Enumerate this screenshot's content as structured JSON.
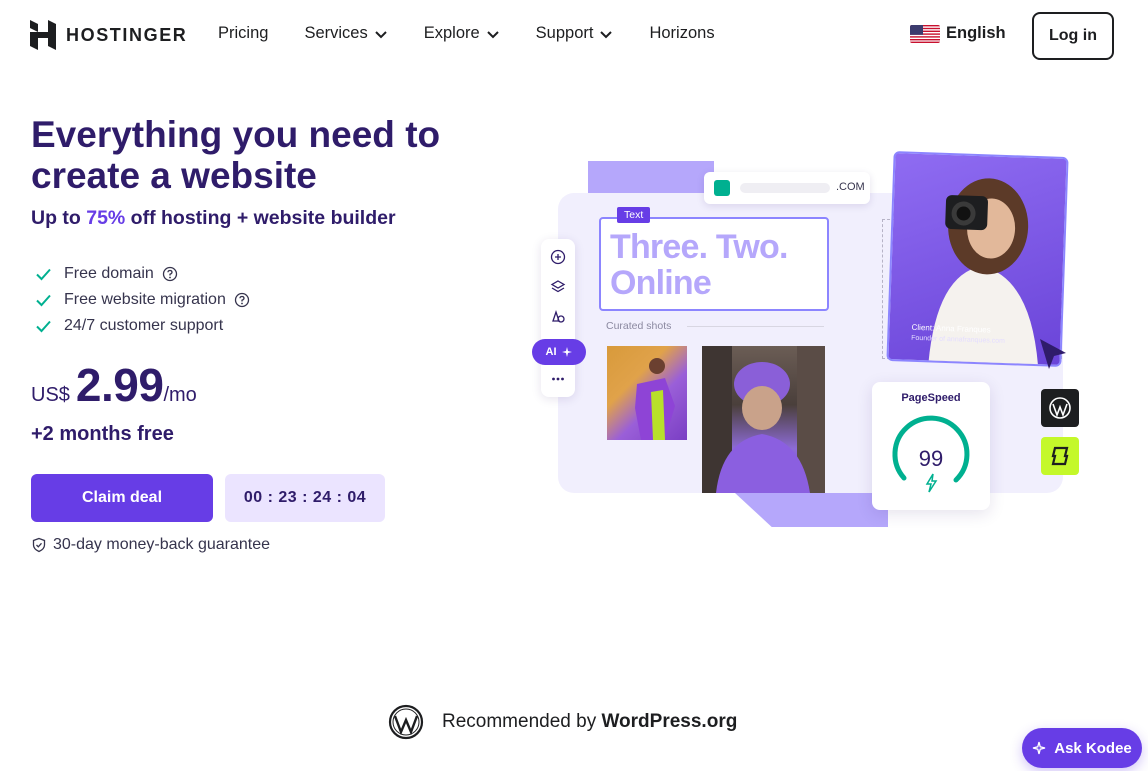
{
  "header": {
    "brand": "HOSTINGER",
    "nav": [
      {
        "label": "Pricing",
        "dropdown": false
      },
      {
        "label": "Services",
        "dropdown": true
      },
      {
        "label": "Explore",
        "dropdown": true
      },
      {
        "label": "Support",
        "dropdown": true
      },
      {
        "label": "Horizons",
        "dropdown": false
      }
    ],
    "language": "English",
    "login_label": "Log in"
  },
  "hero": {
    "title": "Everything you need to create a website",
    "subtitle_prefix": "Up to ",
    "subtitle_accent": "75%",
    "subtitle_suffix": " off hosting + website builder",
    "features": [
      {
        "text": "Free domain",
        "help": true
      },
      {
        "text": "Free website migration",
        "help": true
      },
      {
        "text": "24/7 customer support",
        "help": false
      }
    ],
    "price": {
      "currency": "US$",
      "amount": "2.99",
      "period": "/mo"
    },
    "bonus": "+2 months free",
    "cta_label": "Claim deal",
    "countdown": "00 : 23 : 24 : 04",
    "guarantee": "30-day money-back guarantee"
  },
  "illustration": {
    "url_tld": ".COM",
    "text_tag": "Text",
    "headline": "Three. Two. Online",
    "curated_label": "Curated shots",
    "ai_label": "AI",
    "client_caption": "Client: Anna Franques",
    "client_sub": "Founder of annafranques.com",
    "pagespeed_label": "PageSpeed",
    "pagespeed_score": 99
  },
  "footer": {
    "recommended_prefix": "Recommended by ",
    "recommended_brand": "WordPress.org",
    "assistant_label": "Ask Kodee"
  },
  "colors": {
    "brand_purple": "#673de6",
    "dark_text": "#2f1c6a",
    "light_purple": "#ebe4ff",
    "success_green": "#00b090",
    "lime": "#c4f82a"
  },
  "icons": [
    "hostinger-logo-icon",
    "chevron-down-icon",
    "us-flag-icon",
    "check-icon",
    "help-circle-icon",
    "shield-check-icon",
    "plus-circle-icon",
    "layers-icon",
    "shapes-icon",
    "sparkle-icon",
    "more-icon",
    "lock-icon",
    "cursor-arrow-icon",
    "bolt-icon",
    "wordpress-icon",
    "sparkle-icon"
  ]
}
